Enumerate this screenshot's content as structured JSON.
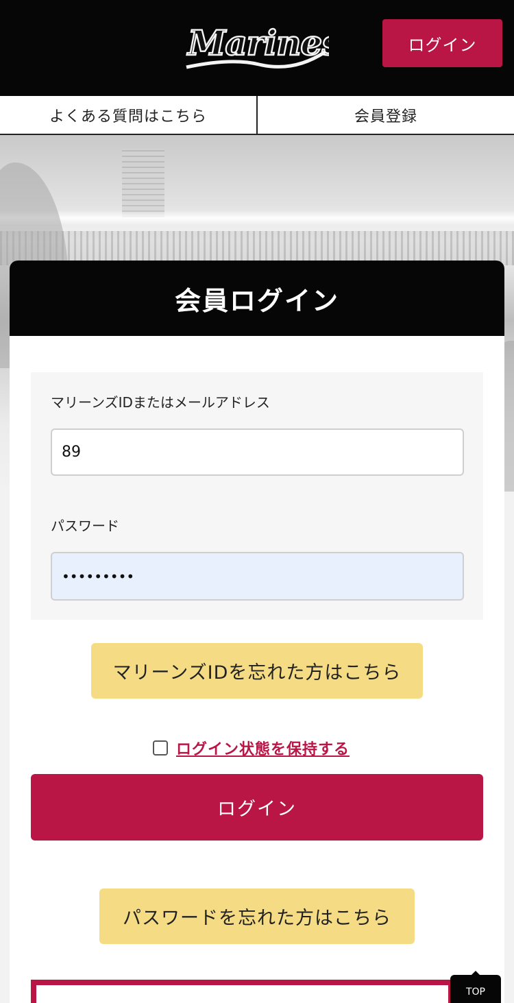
{
  "header": {
    "logo_text": "Marines",
    "login_label": "ログイン"
  },
  "subnav": {
    "faq_label": "よくある質問はこちら",
    "register_label": "会員登録"
  },
  "card": {
    "title": "会員ログイン",
    "id_field": {
      "label": "マリーンズIDまたはメールアドレス",
      "value": "89"
    },
    "password_field": {
      "label": "パスワード",
      "masked_value": "•••••••••"
    },
    "forgot_id_label": "マリーンズIDを忘れた方はこちら",
    "remember_label": "ログイン状態を保持する",
    "remember_checked": false,
    "login_button_label": "ログイン",
    "forgot_password_label": "パスワードを忘れた方はこちら"
  },
  "top_button": {
    "label": "TOP"
  },
  "colors": {
    "brand_red": "#b91646",
    "header_black": "#060606",
    "link_yellow": "#f5dc84",
    "autofill_blue": "#e8f0fe"
  }
}
